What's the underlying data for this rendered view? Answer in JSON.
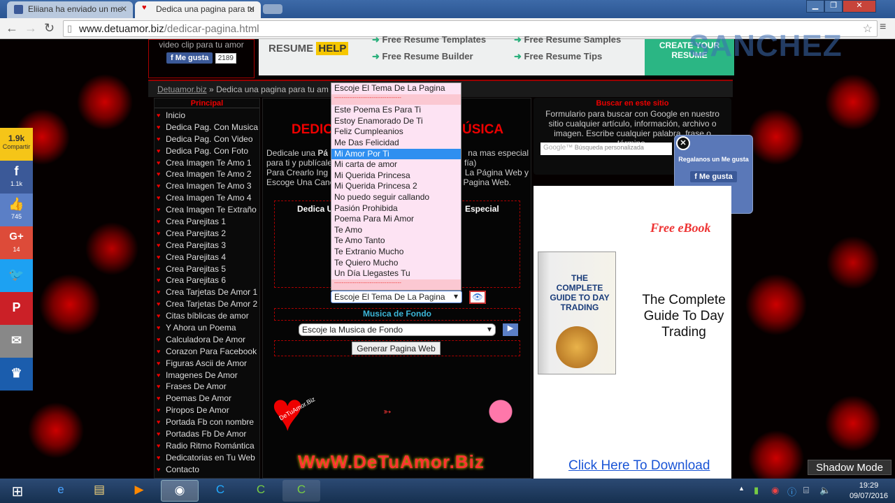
{
  "browser": {
    "tabs": [
      {
        "label": "Eliiana ha enviado un me"
      },
      {
        "label": "Dedica una pagina para tu"
      }
    ],
    "url_host": "www.detuamor.biz",
    "url_path": "/dedicar-pagina.html"
  },
  "header": {
    "fb_caption": "video clip para tu amor",
    "like_label": "Me gusta",
    "like_count": "2189",
    "watermark": "SANCHEZ"
  },
  "ad_top": {
    "brand": "RESUME",
    "brand_highlight": "HELP",
    "links": [
      "Free Resume Templates",
      "Free Resume Samples",
      "Free Resume Builder",
      "Free Resume Tips"
    ],
    "cta": "CREATE YOUR RESUME"
  },
  "breadcrumb": {
    "home": "Detuamor.biz",
    "sep": "»",
    "current": "Dedica una pagina para tu am"
  },
  "sidebar": {
    "heading": "Principal",
    "items": [
      "Inicio",
      "Dedica Pag. Con Musica",
      "Dedica Pag. Con Video",
      "Dedica Pag. Con Foto",
      "Crea Imagen Te Amo 1",
      "Crea Imagen Te Amo 2",
      "Crea Imagen Te Amo 3",
      "Crea Imagen Te Amo 4",
      "Crea Imagen Te Extraño",
      "Crea Parejitas 1",
      "Crea Parejitas 2",
      "Crea Parejitas 3",
      "Crea Parejitas 4",
      "Crea Parejitas 5",
      "Crea Parejitas 6",
      "Crea Tarjetas De Amor 1",
      "Crea Tarjetas De Amor 2",
      "Citas bíblicas de amor",
      "Y Ahora un Poema",
      "Calculadora De Amor",
      "Corazon Para Facebook",
      "Figuras Ascii de Amor",
      "Imagenes De Amor",
      "Frases De Amor",
      "Poemas De Amor",
      "Piropos De Amor",
      "Portada Fb con nombre",
      "Portadas Fb De Amor",
      "Radio Ritmo Romántica",
      "Dedicatorias en Tu Web",
      "Contacto"
    ]
  },
  "main": {
    "title_left": "DEDIC",
    "title_right": "ÚSICA",
    "desc_lines": [
      [
        "Dedicale una ",
        "Pá",
        "na mas especial"
      ],
      [
        "para ti y publícale",
        "fía)"
      ],
      [
        "Para Crearlo Ing",
        "La Página Web y"
      ],
      [
        "Escoge Una Canc",
        "Pagina Web."
      ]
    ],
    "section_left": "Dedica U",
    "section_right": "Especial",
    "theme_select": "Escoje El Tema De La Pagina",
    "music_heading": "Musica de Fondo",
    "music_select": "Escoje la Musica de Fondo",
    "generate_button": "Generar Pagina Web",
    "logo_text": "WwW.DeTuAmor.Biz",
    "heart_text": "DeTuAmor.Biz"
  },
  "dropdown": {
    "header": "Escoje El Tema De La Pagina",
    "separator": "------------------------------------",
    "options": [
      "Este Poema Es Para Ti",
      "Estoy Enamorado De Ti",
      "Feliz Cumpleanios",
      "Me Das Felicidad",
      "Mi Amor Por Ti",
      "Mi carta de amor",
      "Mi Querida Princesa",
      "Mi Querida Princesa 2",
      "No puedo seguir callando",
      "Pasión Prohibida",
      "Poema Para Mi Amor",
      "Te Amo",
      "Te Amo Tanto",
      "Te Extranio Mucho",
      "Te Quiero Mucho",
      "Un Día Llegastes Tu"
    ],
    "highlighted": "Mi Amor Por Ti",
    "highlight_color": "#2f8ff0"
  },
  "search": {
    "heading": "Buscar en este sitio",
    "text": "Formulario para buscar con Google en nuestro sitio cualquier artículo, información, archivo o imagen. Escribe cualquier palabra, frase o término.",
    "placeholder": "Búsqueda personalizada",
    "google": "Google™"
  },
  "popup": {
    "text": "Regalanos un Me gusta",
    "like": "Me gusta"
  },
  "ad_right": {
    "badge": "Free eBook",
    "book_title": "THE COMPLETE GUIDE TO DAY TRADING",
    "headline": "The Complete Guide To Day Trading",
    "download": "Click Here To Download"
  },
  "share": {
    "total": "1.9k",
    "total_label": "Compartir",
    "facebook": "1.1k",
    "like": "745",
    "gplus": "14"
  },
  "overlay": {
    "shadow_mode": "Shadow Mode"
  },
  "taskbar": {
    "time": "19:29",
    "date": "09/07/2016"
  }
}
